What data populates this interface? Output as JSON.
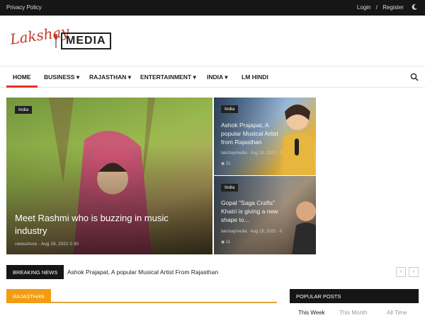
{
  "topbar": {
    "privacy": "Privacy Policy",
    "login": "Login",
    "slash": "/",
    "register": "Register",
    "moon_icon": "moon-icon"
  },
  "logo": {
    "script": "Lakshay",
    "media": "MEDIA"
  },
  "nav": {
    "items": [
      "HOME",
      "BUSINESS",
      "RAJASTHAN",
      "ENTERTAINMENT",
      "INDIA",
      "LM HINDI"
    ],
    "active": "HOME",
    "search_icon": "search-icon",
    "accent": "#e0342a"
  },
  "hero": {
    "main": {
      "tag": "India",
      "title": "Meet Rashmi who is buzzing in music industry",
      "meta": "newsshore · Aug 29, 2022  0  30"
    },
    "side1": {
      "tag": "India",
      "title": "Ashok Prajapat, A popular Musical Artist from Rajasthan",
      "meta": "lakshaymedia · Aug 19, 2022 · 0",
      "views": "21"
    },
    "side2": {
      "tag": "India",
      "title": "Gopal \"Saga Crafts\" Khatri is giving a new shape to...",
      "meta": "lakshaymedia · Aug 19, 2022 · 0",
      "views": "11"
    }
  },
  "breaking": {
    "label": "BREAKING NEWS",
    "text": "Ashok Prajapat, A popular Musical Artist From Rajasthan",
    "prev": "‹",
    "next": "›"
  },
  "sections": {
    "rajasthan": "RAJASTHAN",
    "popular": "POPULAR POSTS",
    "tabs": [
      "This Week",
      "This Month",
      "All Time"
    ]
  }
}
